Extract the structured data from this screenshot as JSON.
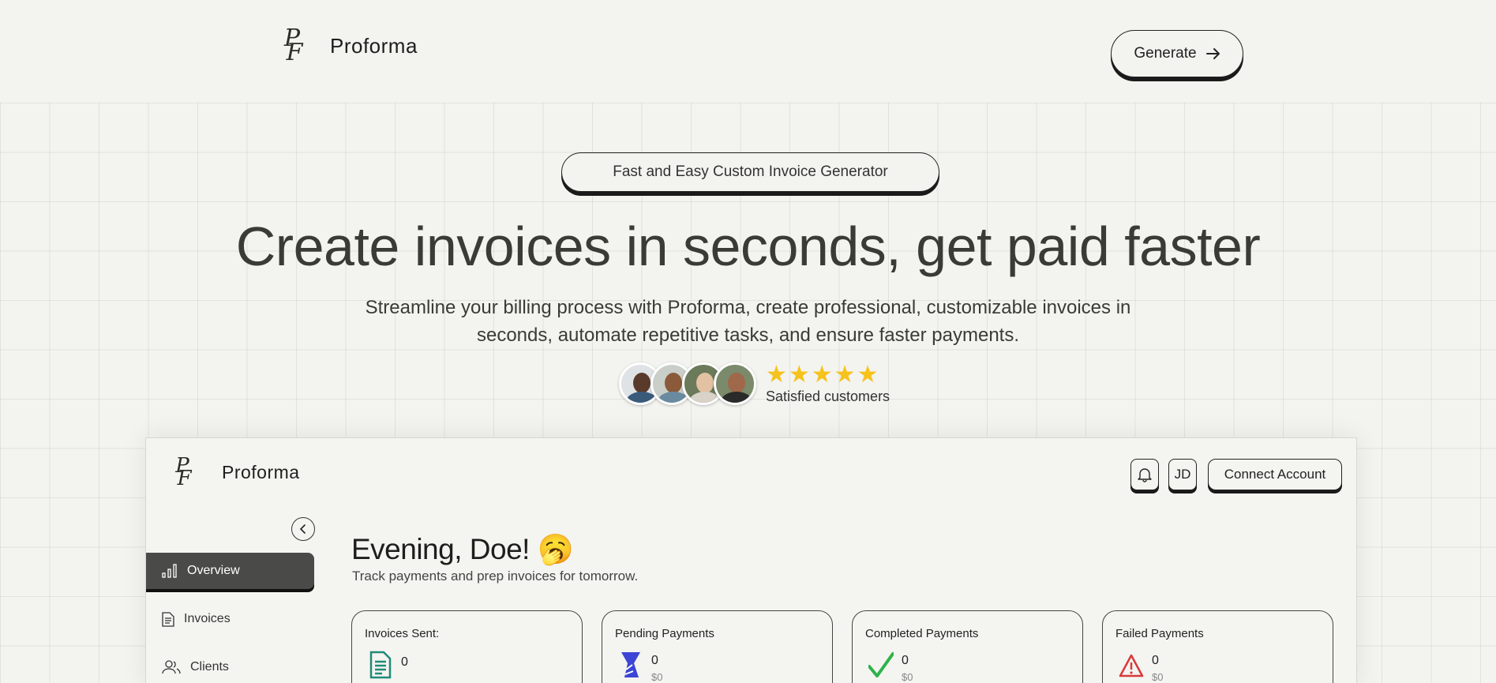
{
  "nav": {
    "logo_mark_top": "P",
    "logo_mark_bottom": "F",
    "brand": "Proforma",
    "generate_label": "Generate"
  },
  "hero": {
    "badge": "Fast and Easy Custom Invoice Generator",
    "title": "Create invoices in seconds, get paid faster",
    "subtitle": "Streamline your billing process with Proforma, create professional, customizable invoices in seconds, automate repetitive tasks, and ensure faster payments.",
    "stars": "★★★★★",
    "rating_label": "Satisfied customers"
  },
  "dashboard": {
    "brand": "Proforma",
    "user_initials": "JD",
    "connect_label": "Connect Account",
    "sidebar": {
      "items": [
        {
          "label": "Overview",
          "icon": "bar-chart-icon",
          "active": true
        },
        {
          "label": "Invoices",
          "icon": "document-icon",
          "active": false
        },
        {
          "label": "Clients",
          "icon": "users-icon",
          "active": false
        }
      ]
    },
    "greeting": "Evening, Doe! 🥱",
    "greeting_sub": "Track payments and prep invoices for tomorrow.",
    "cards": [
      {
        "title": "Invoices Sent:",
        "value": "0",
        "amount": "",
        "icon": "invoice-doc-icon",
        "color": "#1f8a7a"
      },
      {
        "title": "Pending Payments",
        "value": "0",
        "amount": "$0",
        "icon": "hourglass-icon",
        "color": "#3b45d6"
      },
      {
        "title": "Completed Payments",
        "value": "0",
        "amount": "$0",
        "icon": "check-icon",
        "color": "#2db34a"
      },
      {
        "title": "Failed Payments",
        "value": "0",
        "amount": "$0",
        "icon": "warning-icon",
        "color": "#d83a3a"
      }
    ]
  }
}
